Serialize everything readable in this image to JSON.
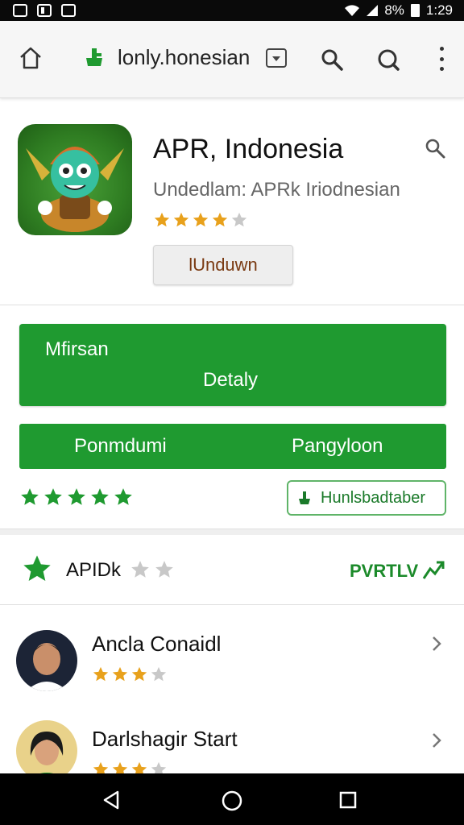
{
  "status_bar": {
    "battery": "8%",
    "time": "1:29"
  },
  "app_bar": {
    "title": "lonly.honesian"
  },
  "header": {
    "app_title": "APR, Indonesia",
    "subtitle": "Undedlam: APRk Iriodnesian",
    "rating_stars": 4,
    "download_label": "lUnduwn"
  },
  "green_block": {
    "title": "Mfirsan",
    "subtitle": "Detaly"
  },
  "green_bar": {
    "left_label": "Ponmdumi",
    "right_label": "Pangyloon"
  },
  "green_stars": 5,
  "outline_button": {
    "label": "Hunlsbadtaber",
    "icon": "download-icon"
  },
  "rating_section": {
    "label": "APIDk",
    "grey_stars": 2,
    "link_label": "PVRTLV",
    "link_icon": "trend-arrow-icon"
  },
  "reviews": [
    {
      "name": "Ancla Conaidl",
      "stars": 3,
      "max_stars": 4
    },
    {
      "name": "Darlshagir Start",
      "stars": 3,
      "max_stars": 4
    }
  ],
  "colors": {
    "green": "#1f9a30",
    "star_gold": "#e8a11c",
    "star_grey": "#c8c8c8"
  }
}
